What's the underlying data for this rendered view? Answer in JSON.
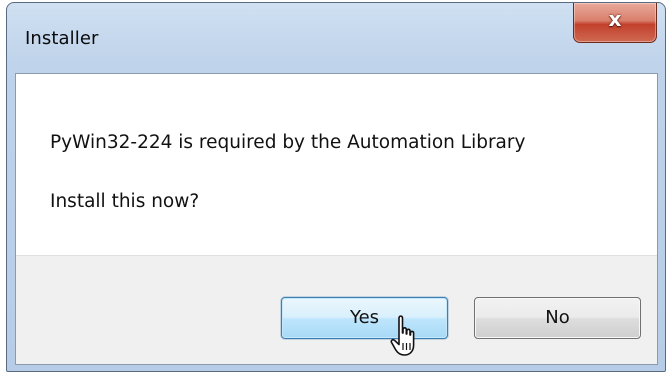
{
  "window": {
    "title": "Installer",
    "close_glyph": "x"
  },
  "dialog": {
    "message": "PyWin32-224 is required by the Automation Library",
    "question": "Install this now?"
  },
  "buttons": {
    "yes_label": "Yes",
    "no_label": "No"
  },
  "icons": {
    "close": "close-icon",
    "cursor": "hand-pointer-cursor"
  },
  "colors": {
    "titlebar": "#bfd3ea",
    "close_button": "#c2402c",
    "default_button_border": "#3c7fb1",
    "button_bar": "#f0f0f0"
  }
}
